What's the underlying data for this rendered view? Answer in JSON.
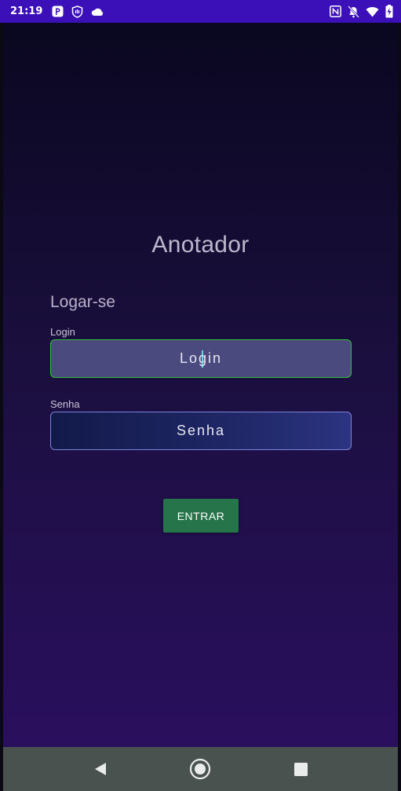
{
  "status_bar": {
    "time": "21:19",
    "left_icons": [
      "parking-icon",
      "shield-hand-icon",
      "cloud-icon"
    ],
    "right_icons": [
      "nfc-icon",
      "muted-bell-icon",
      "wifi-icon",
      "battery-charging-icon"
    ],
    "background_color": "#3b10b8"
  },
  "app": {
    "title": "Anotador",
    "section_heading": "Logar-se",
    "login": {
      "label": "Login",
      "value": "Login",
      "focused": true
    },
    "senha": {
      "label": "Senha",
      "value": "Senha"
    },
    "enter_button": "ENTRAR",
    "accent_color": "#26744a"
  },
  "nav_bar": {
    "buttons": [
      "back-icon",
      "home-icon",
      "recents-icon"
    ]
  }
}
